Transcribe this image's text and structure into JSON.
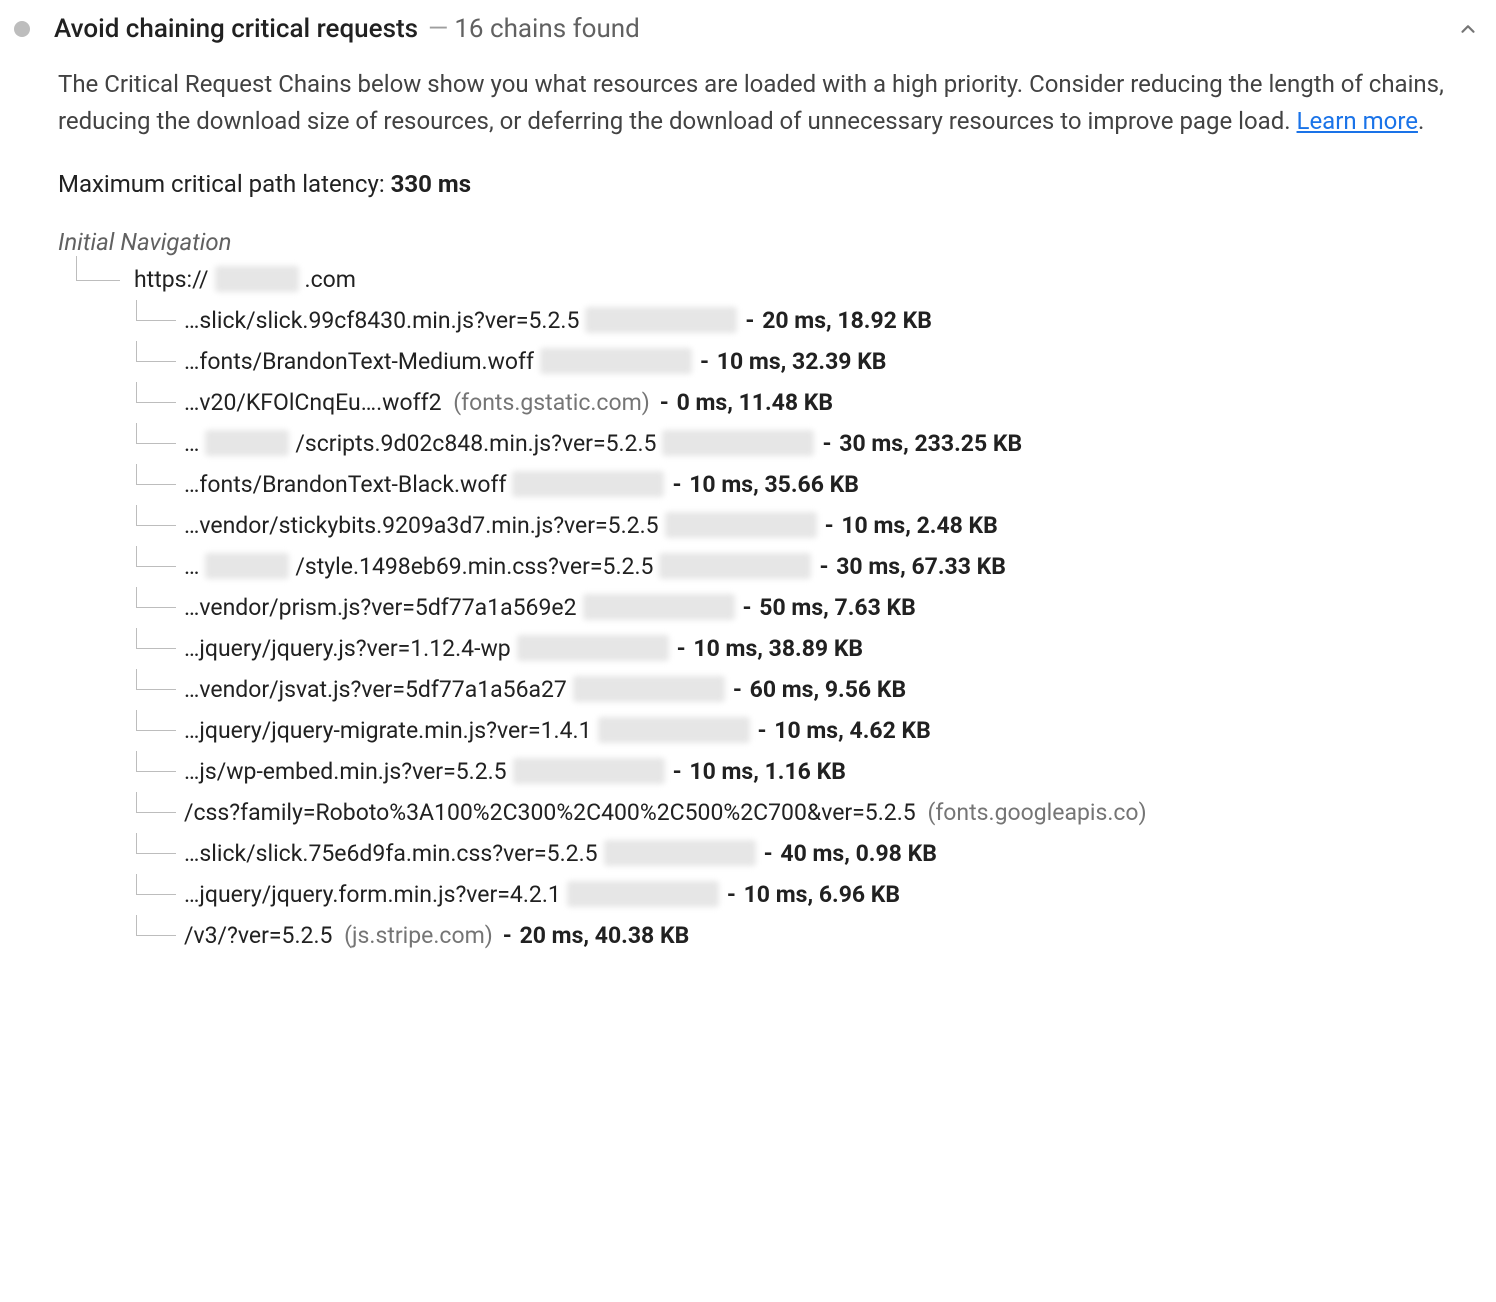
{
  "audit": {
    "title": "Avoid chaining critical requests",
    "count_label": "16 chains found",
    "description_pre": "The Critical Request Chains below show you what resources are loaded with a high priority. Consider reducing the length of chains, reducing the download size of resources, or deferring the download of unnecessary resources to improve page load. ",
    "learn_more": "Learn more",
    "description_post": ".",
    "max_latency_label": "Maximum critical path latency: ",
    "max_latency_value": "330 ms",
    "initial_nav_label": "Initial Navigation",
    "root_url_prefix": "https://",
    "root_url_suffix": ".com"
  },
  "chain": [
    {
      "path": "…slick/slick.99cf8430.min.js?ver=5.2.5",
      "origin_blur": true,
      "time": "20 ms",
      "size": "18.92 KB"
    },
    {
      "path": "…fonts/BrandonText-Medium.woff",
      "origin_blur": true,
      "time": "10 ms",
      "size": "32.39 KB"
    },
    {
      "path": "…v20/KFOlCnqEu….woff2",
      "origin_text": "fonts.gstatic.com",
      "time": "0 ms",
      "size": "11.48 KB"
    },
    {
      "path_prefix": "…",
      "path_blur": true,
      "path_suffix": "/scripts.9d02c848.min.js?ver=5.2.5",
      "origin_blur": true,
      "time": "30 ms",
      "size": "233.25 KB"
    },
    {
      "path": "…fonts/BrandonText-Black.woff",
      "origin_blur": true,
      "time": "10 ms",
      "size": "35.66 KB"
    },
    {
      "path": "…vendor/stickybits.9209a3d7.min.js?ver=5.2.5",
      "origin_blur": true,
      "time": "10 ms",
      "size": "2.48 KB"
    },
    {
      "path_prefix": "…",
      "path_blur": true,
      "path_suffix": "/style.1498eb69.min.css?ver=5.2.5",
      "origin_blur": true,
      "time": "30 ms",
      "size": "67.33 KB"
    },
    {
      "path": "…vendor/prism.js?ver=5df77a1a569e2",
      "origin_blur": true,
      "time": "50 ms",
      "size": "7.63 KB"
    },
    {
      "path": "…jquery/jquery.js?ver=1.12.4-wp",
      "origin_blur": true,
      "time": "10 ms",
      "size": "38.89 KB"
    },
    {
      "path": "…vendor/jsvat.js?ver=5df77a1a56a27",
      "origin_blur": true,
      "time": "60 ms",
      "size": "9.56 KB"
    },
    {
      "path": "…jquery/jquery-migrate.min.js?ver=1.4.1",
      "origin_blur": true,
      "time": "10 ms",
      "size": "4.62 KB"
    },
    {
      "path": "…js/wp-embed.min.js?ver=5.2.5",
      "origin_blur": true,
      "time": "10 ms",
      "size": "1.16 KB"
    },
    {
      "path": "/css?family=Roboto%3A100%2C300%2C400%2C500%2C700&ver=5.2.5",
      "origin_text": "fonts.googleapis.co",
      "no_stats": true
    },
    {
      "path": "…slick/slick.75e6d9fa.min.css?ver=5.2.5",
      "origin_blur": true,
      "time": "40 ms",
      "size": "0.98 KB"
    },
    {
      "path": "…jquery/jquery.form.min.js?ver=4.2.1",
      "origin_blur": true,
      "time": "10 ms",
      "size": "6.96 KB"
    },
    {
      "path": "/v3/?ver=5.2.5",
      "origin_text": "js.stripe.com",
      "time": "20 ms",
      "size": "40.38 KB"
    }
  ]
}
